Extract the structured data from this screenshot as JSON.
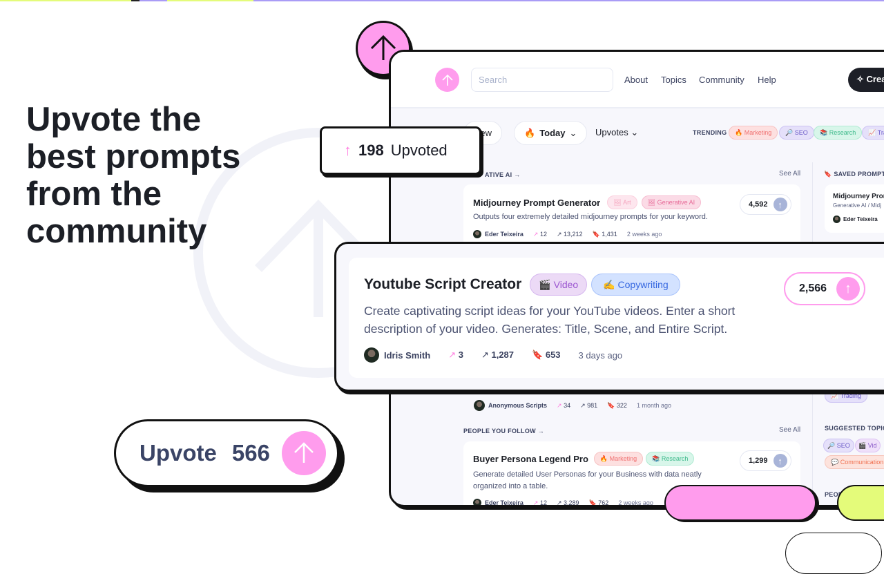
{
  "hero": {
    "headline": "Upvote the best prompts from the community"
  },
  "badge": {
    "count": "198",
    "label": "Upvoted"
  },
  "upvote_button": {
    "label": "Upvote",
    "count": "566"
  },
  "header": {
    "search_placeholder": "Search",
    "nav": [
      "About",
      "Topics",
      "Community",
      "Help"
    ],
    "create_label": "Crea"
  },
  "filters": {
    "new": "New",
    "today": "Today",
    "sort": "Upvotes",
    "trending_label": "TRENDING",
    "trending": [
      "Marketing",
      "SEO",
      "Research",
      "Tra"
    ]
  },
  "sections": {
    "generative": "ATIVE AI →",
    "see_all": "See All",
    "people": "PEOPLE YOU FOLLOW →"
  },
  "cards": [
    {
      "title": "Midjourney Prompt Generator",
      "tags": [
        "Art",
        "Generative AI"
      ],
      "desc": "Outputs four extremely detailed midjourney prompts for your keyword.",
      "author": "Eder Teixeira",
      "remixes": "12",
      "views": "13,212",
      "saves": "1,431",
      "time": "2 weeks ago",
      "votes": "4,592"
    },
    {
      "title": "Youtube Script Creator",
      "tags": [
        "Video",
        "Copywriting"
      ],
      "desc": "Create captivating script ideas for your YouTube videos. Enter a short description of your video. Generates: Title, Scene, and Entire Script.",
      "author": "Idris Smith",
      "remixes": "3",
      "views": "1,287",
      "saves": "653",
      "time": "3 days ago",
      "votes": "2,566"
    },
    {
      "author": "Anonymous Scripts",
      "remixes": "34",
      "views": "981",
      "saves": "322",
      "time": "1 month ago"
    },
    {
      "title": "Buyer Persona Legend Pro",
      "tags": [
        "Marketing",
        "Research"
      ],
      "desc": "Generate detailed User Personas for your Business with data neatly organized into a table.",
      "author": "Eder Teixeira",
      "remixes": "12",
      "views": "3,289",
      "saves": "762",
      "time": "2 weeks ago",
      "votes": "1,299"
    }
  ],
  "sidebar": {
    "saved_label": "SAVED PROMPTS",
    "saved_title": "Midjourney Prom",
    "saved_sub": "Generative AI / Midj",
    "saved_author": "Eder Teixeira",
    "trading": "Trading",
    "suggested_label": "SUGGESTED TOPICS",
    "suggested": [
      "SEO",
      "Vid",
      "Communication"
    ],
    "people": "PEOP"
  },
  "colors": {
    "pink": "#ff9ced",
    "lime": "#e4fb7a",
    "purple": "#a99cf6",
    "dark": "#1d1f27"
  }
}
